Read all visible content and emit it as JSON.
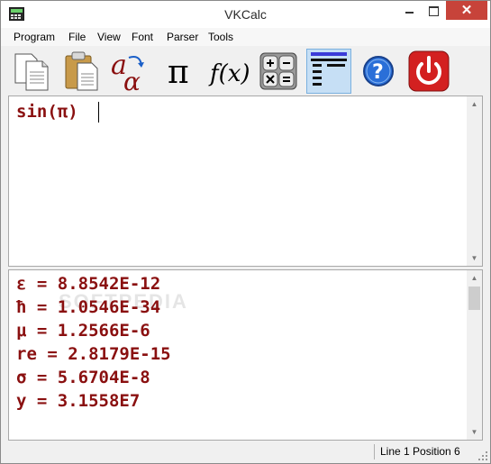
{
  "window": {
    "title": "VKCalc"
  },
  "menu": [
    "Program",
    "File",
    "View",
    "Font",
    "Parser",
    "Tools"
  ],
  "toolbar": [
    {
      "name": "copy-icon"
    },
    {
      "name": "paste-icon"
    },
    {
      "name": "font-icon"
    },
    {
      "name": "pi-icon"
    },
    {
      "name": "function-icon"
    },
    {
      "name": "calculator-icon"
    },
    {
      "name": "align-icon",
      "active": true
    },
    {
      "name": "help-icon"
    },
    {
      "name": "power-icon"
    }
  ],
  "toolbar_text": {
    "font": "a",
    "font_sub": "α",
    "pi": "π",
    "function": "f(x)",
    "help": "?"
  },
  "input": {
    "expression": "sin(π)"
  },
  "output": {
    "lines": [
      "ε = 8.8542E-12",
      "ħ = 1.0546E-34",
      "μ = 1.2566E-6",
      "re = 2.8179E-15",
      "σ = 5.6704E-8",
      "y = 3.1558E7"
    ]
  },
  "watermark": "SOFTPEDIA",
  "status": {
    "text": "Line 1  Position 6"
  },
  "colors": {
    "result_text": "#8a1010",
    "close": "#c7433a",
    "active_tool": "#c6dff5"
  }
}
